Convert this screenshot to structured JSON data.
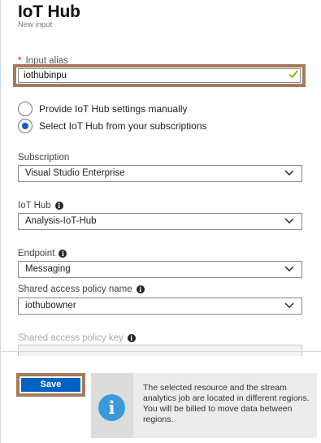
{
  "header": {
    "title": "IoT Hub",
    "subtitle": "New input"
  },
  "input_alias": {
    "label": "Input alias",
    "required_mark": "*",
    "value": "iothubinpu",
    "valid": true
  },
  "radio_options": [
    {
      "label": "Provide IoT Hub settings manually",
      "selected": false
    },
    {
      "label": "Select IoT Hub from your subscriptions",
      "selected": true
    }
  ],
  "subscription": {
    "label": "Subscription",
    "value": "Visual Studio Enterprise"
  },
  "iot_hub": {
    "label": "IoT Hub",
    "value": "Analysis-IoT-Hub"
  },
  "endpoint": {
    "label": "Endpoint",
    "value": "Messaging"
  },
  "policy_name": {
    "label": "Shared access policy name",
    "value": "iothubowner"
  },
  "policy_key": {
    "label": "Shared access policy key"
  },
  "footer": {
    "save_label": "Save",
    "info_message": "The selected resource and the stream analytics job are located in different regions. You will be billed to move data between regions."
  },
  "colors": {
    "accent": "#0063c3",
    "highlight_border": "#a57a5b",
    "valid_check": "#7fba00",
    "info_icon": "#3a9ad9"
  }
}
